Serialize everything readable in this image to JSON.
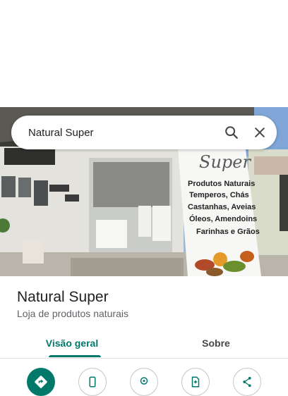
{
  "search": {
    "query": "Natural Super"
  },
  "place": {
    "name": "Natural Super",
    "category": "Loja de produtos naturais"
  },
  "banner": {
    "brand": "Super",
    "lines": [
      "Produtos Naturais",
      "Temperos, Chás",
      "Castanhas, Aveias",
      "Óleos, Amendoins",
      "Farinhas e Grãos"
    ]
  },
  "tabs": [
    {
      "label": "Visão geral",
      "active": true
    },
    {
      "label": "Sobre",
      "active": false
    }
  ],
  "actions": [
    {
      "icon": "directions-icon"
    },
    {
      "icon": "phone-icon"
    },
    {
      "icon": "street-view-icon"
    },
    {
      "icon": "save-place-icon"
    },
    {
      "icon": "share-icon"
    }
  ],
  "colors": {
    "accent": "#00796b",
    "text": "#202124",
    "secondary_text": "#5f6368"
  }
}
